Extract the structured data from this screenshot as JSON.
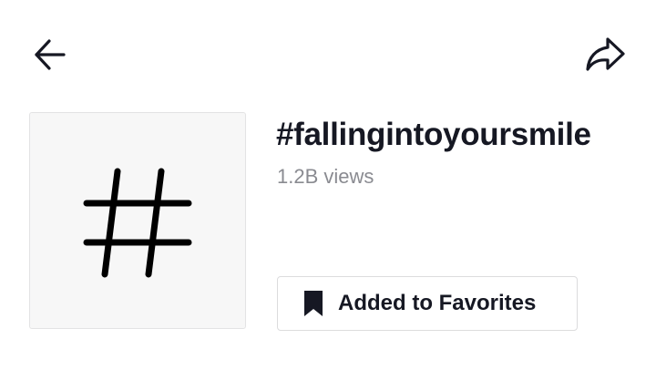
{
  "header": {
    "back_icon": "arrow-left-icon",
    "share_icon": "share-arrow-icon"
  },
  "hashtag": {
    "cover_icon": "hashtag-icon",
    "title": "#fallingintoyoursmile",
    "views": "1.2B views"
  },
  "favorites": {
    "icon": "bookmark-icon",
    "label": "Added to Favorites"
  },
  "colors": {
    "text_primary": "#161823",
    "text_secondary": "#8a8b91",
    "cover_background": "#f7f7f7",
    "border": "#dcdcdd"
  }
}
